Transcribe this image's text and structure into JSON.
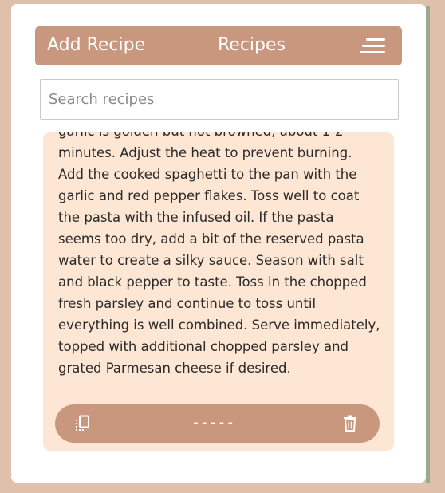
{
  "header": {
    "add_recipe_label": "Add Recipe",
    "title": "Recipes",
    "menu_icon": "hamburger-menu-icon"
  },
  "search": {
    "placeholder": "Search recipes",
    "value": ""
  },
  "recipe_card": {
    "instructions": "garlic is golden but not browned, about 1-2 minutes. Adjust the heat to prevent burning. Add the cooked spaghetti to the pan with the garlic and red pepper flakes. Toss well to coat the pasta with the infused oil. If the pasta seems too dry, add a bit of the reserved pasta water to create a silky sauce. Season with salt and black pepper to taste. Toss in the chopped fresh parsley and continue to toss until everything is well combined. Serve immediately, topped with additional chopped parsley and grated Parmesan cheese if desired.",
    "footer": {
      "copy_icon": "copy-icon",
      "dashes": "-----",
      "delete_icon": "trash-icon"
    }
  },
  "colors": {
    "page_background": "#dfc0ab",
    "accent": "#c9977e",
    "card_background": "#fde6d4",
    "text": "#2a2a2a"
  }
}
